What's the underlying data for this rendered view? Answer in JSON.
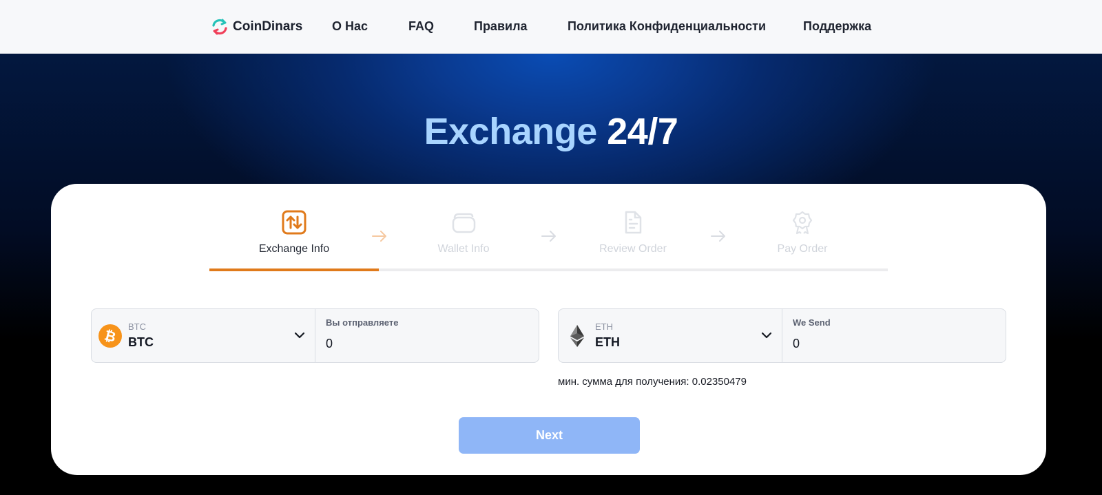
{
  "nav": {
    "brand": "CoinDinars",
    "links": [
      "О Нас",
      "FAQ",
      "Правила",
      "Политика Конфиденциальности",
      "Поддержка"
    ]
  },
  "hero": {
    "title_part1": "Exchange",
    "title_part2": "24/7"
  },
  "steps": [
    {
      "label": "Exchange Info",
      "icon": "swap-arrows-icon",
      "active": true
    },
    {
      "label": "Wallet Info",
      "icon": "wallet-icon",
      "active": false
    },
    {
      "label": "Review Order",
      "icon": "document-icon",
      "active": false
    },
    {
      "label": "Pay Order",
      "icon": "award-badge-icon",
      "active": false
    }
  ],
  "progress_fraction": 0.25,
  "send": {
    "coin_caption": "BTC",
    "coin_name": "BTC",
    "amount_label": "Вы отправляете",
    "amount_value": "0"
  },
  "receive": {
    "coin_caption": "ETH",
    "coin_name": "ETH",
    "amount_label": "We Send",
    "amount_value": "0"
  },
  "min_note": "мин. сумма для получения: 0.02350479",
  "next_label": "Next",
  "colors": {
    "accent_orange": "#e07a1b",
    "button_blue": "#8fb6f7",
    "hero_title_light": "#a8d4ff"
  }
}
